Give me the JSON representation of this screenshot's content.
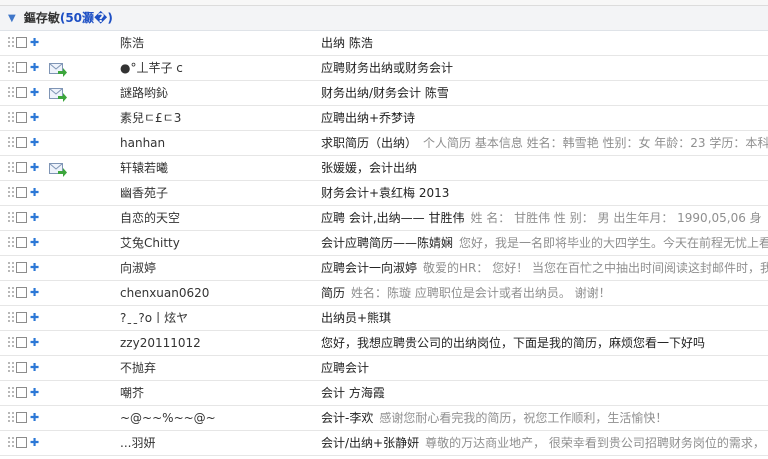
{
  "group": {
    "title": "鏂存敏",
    "count": "(50灏�)"
  },
  "emails": [
    {
      "sender": "陈浩",
      "subject": "出纳 陈浩",
      "preview": "",
      "has_envelope": false
    },
    {
      "sender": "●°丄芊子 c",
      "subject": "应聘财务出纳或财务会计",
      "preview": "",
      "has_envelope": true
    },
    {
      "sender": "謎路哟鈊",
      "subject": "财务出纳/财务会计 陈雪",
      "preview": "",
      "has_envelope": true
    },
    {
      "sender": "素兒ㄷ£ㄷ3",
      "subject": "应聘出纳+乔梦诗",
      "preview": "",
      "has_envelope": false
    },
    {
      "sender": "hanhan",
      "subject": "求职简历（出纳）",
      "preview": "个人简历 基本信息 姓名：韩雪艳 性别：女 年龄：23 学历：本科",
      "has_envelope": false
    },
    {
      "sender": "轩辕若曦",
      "subject": "张媛媛，会计出纳",
      "preview": "",
      "has_envelope": true
    },
    {
      "sender": "幽香苑子",
      "subject": "财务会计+袁红梅 2013",
      "preview": "",
      "has_envelope": false
    },
    {
      "sender": "自恋的天空",
      "subject": "应聘 会计,出纳—— 甘胜伟",
      "preview": "姓 名：  甘胜伟 性    别：  男 出生年月：  1990,05,06 身",
      "has_envelope": false
    },
    {
      "sender": "艾兔Chitty",
      "subject": "会计应聘简历——陈婧娴",
      "preview": "您好，我是一名即将毕业的大四学生。今天在前程无忧上看",
      "has_envelope": false
    },
    {
      "sender": "向淑婷",
      "subject": "应聘会计一向淑婷",
      "preview": "敬爱的HR：  您好！  当您在百忙之中抽出时间阅读这封邮件时，我",
      "has_envelope": false
    },
    {
      "sender": "chenxuan0620",
      "subject": "简历",
      "preview": "姓名：陈璇 应聘职位是会计或者出纳员。 谢谢！",
      "has_envelope": false
    },
    {
      "sender": "?ˍˍ?o丨炫ヤ",
      "subject": "出纳员+熊琪",
      "preview": "",
      "has_envelope": false
    },
    {
      "sender": "zzy20111012",
      "subject": "您好，我想应聘贵公司的出纳岗位，下面是我的简历，麻烦您看一下好吗",
      "preview": "",
      "has_envelope": false
    },
    {
      "sender": "不抛弃",
      "subject": "应聘会计",
      "preview": "",
      "has_envelope": false
    },
    {
      "sender": "嘲芥",
      "subject": "会计 方海霞",
      "preview": "",
      "has_envelope": false
    },
    {
      "sender": "~@~~%~~@~",
      "subject": "会计-李欢",
      "preview": "感谢您耐心看完我的简历，祝您工作顺利，生活愉快！",
      "has_envelope": false
    },
    {
      "sender": "...羽妍",
      "subject": "会计/出纳+张静妍",
      "preview": "尊敬的万达商业地产，  很荣幸看到贵公司招聘财务岗位的需求，",
      "has_envelope": false
    }
  ],
  "colors": {
    "accent": "#2a77d6",
    "count": "#1d4fc4",
    "preview": "#8f8f8f",
    "envelope_green": "#3ca63c"
  },
  "icons": {
    "drag": "drag-handle-icon",
    "plus": "plus-icon",
    "envelope": "mail-arrow-icon",
    "collapse": "chevron-down-icon"
  }
}
